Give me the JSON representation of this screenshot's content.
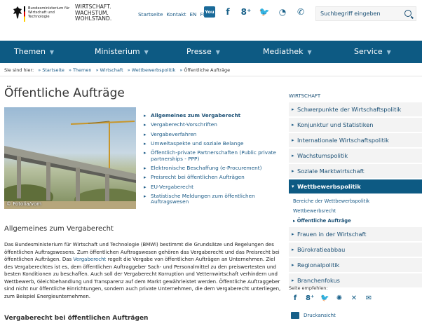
{
  "header": {
    "ministry_name": "Bundesministerium für Wirtschaft und Technologie",
    "slogan_lines": [
      "WIRTSCHAFT.",
      "WACHSTUM.",
      "WOHLSTAND."
    ],
    "top_links": [
      "Startseite",
      "Kontakt",
      "EN",
      "FR"
    ],
    "social_icons": [
      "youtube-icon",
      "facebook-icon",
      "googleplus-icon",
      "twitter-icon",
      "rss-icon",
      "mobile-icon",
      "app-icon"
    ],
    "search_placeholder": "Suchbegriff eingeben"
  },
  "nav": {
    "items": [
      "Themen",
      "Ministerium",
      "Presse",
      "Mediathek",
      "Service"
    ]
  },
  "breadcrumb": {
    "prefix": "Sie sind hier:",
    "items": [
      "Startseite",
      "Themen",
      "Wirtschaft",
      "Wettbewerbspolitik",
      "Öffentliche Aufträge"
    ]
  },
  "main": {
    "title": "Öffentliche Aufträge",
    "photo_caption": "© Fotolia/vom",
    "topics": [
      "Allgemeines zum Vergaberecht",
      "Vergaberecht-Vorschriften",
      "Vergabeverfahren",
      "Umweltaspekte und soziale Belange",
      "Öffentlich-private Partnerschaften (Public private partnerships - PPP)",
      "Elektronische Beschaffung (e-Procurement)",
      "Preisrecht bei öffentlichen Aufträgen",
      "EU-Vergaberecht",
      "Statistische Meldungen zum öffentlichen Auftragswesen"
    ],
    "section_title": "Allgemeines zum Vergaberecht",
    "paragraph_before_link": "Das Bundesministerium für Wirtschaft und Technologie (BMWi) bestimmt die Grundsätze und Regelungen des öffentlichen Auftragswesens. Zum öffentlichen Auftragswesen gehören das Vergaberecht und das Preisrecht bei öffentlichen Aufträgen. Das ",
    "paragraph_link": "Vergaberecht",
    "paragraph_after_link": " regelt die Vergabe von öffentlichen Aufträgen an Unternehmen.  Ziel des Vergaberechtes ist es, dem öffentlichen Auftraggeber Sach- und Personalmittel zu den preiswertesten und besten Konditionen zu beschaffen. Auch soll der Vergaberecht Korruption und Vetternwirtschaft verhindern und Wettbewerb, Gleichbehandlung und Transparenz auf dem Markt gewährleistet werden.  Öffentliche Auftraggeber sind nicht nur öffentliche Einrichtungen, sondern auch private Unternehmen, die dem Vergaberecht unterliegen, zum Beispiel Energieunternehmen.",
    "subsection_title": "Vergaberecht bei öffentlichen Aufträgen"
  },
  "sidebar": {
    "heading": "WIRTSCHAFT",
    "items_before": [
      "Schwerpunkte der Wirtschaftspolitik",
      "Konjunktur und Statistiken",
      "Internationale Wirtschaftspolitik",
      "Wachstumspolitik",
      "Soziale Marktwirtschaft"
    ],
    "active_item": "Wettbewerbspolitik",
    "sub_items": [
      "Bereiche der Wettbewerbspolitik",
      "Wettbewerbsrecht",
      "Öffentliche Aufträge"
    ],
    "items_after": [
      "Frauen in der Wirtschaft",
      "Bürokratieabbau",
      "Regionalpolitik",
      "Branchenfokus"
    ],
    "recommend_label": "Seite empfehlen:",
    "share_icons": [
      "facebook-icon",
      "googleplus-icon",
      "twitter-icon",
      "delicious-icon",
      "xing-icon",
      "email-icon"
    ],
    "print_label": "Druckansicht"
  }
}
